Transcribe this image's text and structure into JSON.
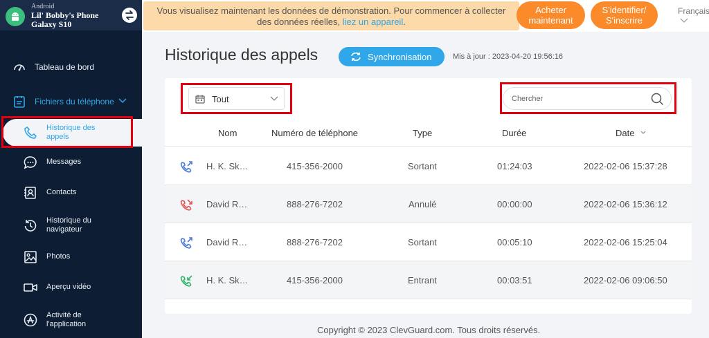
{
  "device": {
    "os": "Android",
    "name": "Lil' Bobby's Phone",
    "model": "Galaxy S10"
  },
  "sidebar": {
    "dashboard": "Tableau de bord",
    "files_group": "Fichiers du téléphone",
    "items": [
      {
        "label_1": "Historique des",
        "label_2": "appels"
      },
      {
        "label": "Messages"
      },
      {
        "label": "Contacts"
      },
      {
        "label_1": "Historique du",
        "label_2": "navigateur"
      },
      {
        "label": "Photos"
      },
      {
        "label": "Aperçu vidéo"
      },
      {
        "label_1": "Activité de",
        "label_2": "l'application"
      }
    ]
  },
  "banner": {
    "message_line1": "Vous visualisez maintenant les données de démonstration. Pour commencer à collecter",
    "message_line2_prefix": "des données réelles,",
    "message_link": "liez un appareil",
    "message_suffix": ".",
    "buy_line1": "Acheter",
    "buy_line2": "maintenant",
    "login_line1": "S'identifier/",
    "login_line2": "S'inscrire",
    "language": "Français"
  },
  "page": {
    "title": "Historique des appels",
    "sync_label": "Synchronisation",
    "updated": "Mis à jour : 2023-04-20 19:56:16"
  },
  "filter": {
    "selected": "Tout"
  },
  "search": {
    "placeholder": "Chercher"
  },
  "table": {
    "headers": {
      "name": "Nom",
      "phone": "Numéro de téléphone",
      "type": "Type",
      "duration": "Durée",
      "date": "Date"
    },
    "rows": [
      {
        "icon": "outgoing-call-icon",
        "color": "#4a7bd6",
        "name": "H. K. Sk…",
        "phone": "415-356-2000",
        "type": "Sortant",
        "duration": "01:24:03",
        "date": "2022-02-06 15:37:28"
      },
      {
        "icon": "missed-call-icon",
        "color": "#e25656",
        "name": "David R…",
        "phone": "888-276-7202",
        "type": "Annulé",
        "duration": "00:00:00",
        "date": "2022-02-06 15:36:12"
      },
      {
        "icon": "outgoing-call-icon",
        "color": "#4a7bd6",
        "name": "David R…",
        "phone": "888-276-7202",
        "type": "Sortant",
        "duration": "00:05:10",
        "date": "2022-02-06 15:25:04"
      },
      {
        "icon": "incoming-call-icon",
        "color": "#2fb36a",
        "name": "H. K. Sk…",
        "phone": "415-356-2000",
        "type": "Entrant",
        "duration": "00:03:51",
        "date": "2022-02-06 09:06:50"
      }
    ]
  },
  "footer": {
    "copyright": "Copyright © 2023 ClevGuard.com. Tous droits réservés."
  },
  "colors": {
    "sidebar_bg": "#0d1d33",
    "accent_blue": "#2fa7e8",
    "accent_orange": "#fa8a2a",
    "banner_bg": "#fbd9a8",
    "highlight_red": "#e4000f"
  }
}
